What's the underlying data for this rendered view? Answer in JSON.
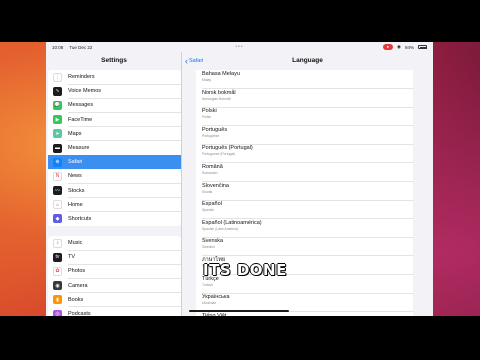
{
  "status_bar": {
    "time": "10:08",
    "date": "Tue Dec 22",
    "dots": "•••",
    "recording": "●",
    "wifi": "◉",
    "battery_pct": "94%"
  },
  "left": {
    "title": "Settings",
    "group1": [
      {
        "label": "Reminders",
        "icon": "reminders-icon",
        "color": "#ffffff",
        "glyph": "⋮"
      },
      {
        "label": "Voice Memos",
        "icon": "voice-memos-icon",
        "color": "#1c1c1e",
        "glyph": "∿"
      },
      {
        "label": "Messages",
        "icon": "messages-icon",
        "color": "#34c759",
        "glyph": "💬"
      },
      {
        "label": "FaceTime",
        "icon": "facetime-icon",
        "color": "#34c759",
        "glyph": "▶"
      },
      {
        "label": "Maps",
        "icon": "maps-icon",
        "color": "#5ac8a0",
        "glyph": "➤"
      },
      {
        "label": "Measure",
        "icon": "measure-icon",
        "color": "#1c1c1e",
        "glyph": "▬"
      },
      {
        "label": "Safari",
        "icon": "safari-icon",
        "color": "#0a84ff",
        "glyph": "⊕",
        "selected": true
      },
      {
        "label": "News",
        "icon": "news-icon",
        "color": "#ffffff",
        "glyph": "N"
      },
      {
        "label": "Stocks",
        "icon": "stocks-icon",
        "color": "#1c1c1e",
        "glyph": "〰"
      },
      {
        "label": "Home",
        "icon": "home-icon",
        "color": "#ffffff",
        "glyph": "⌂"
      },
      {
        "label": "Shortcuts",
        "icon": "shortcuts-icon",
        "color": "#5e5ce6",
        "glyph": "◆"
      }
    ],
    "group2": [
      {
        "label": "Music",
        "icon": "music-icon",
        "color": "#ffffff",
        "glyph": "♪"
      },
      {
        "label": "TV",
        "icon": "tv-icon",
        "color": "#1c1c1e",
        "glyph": "tv"
      },
      {
        "label": "Photos",
        "icon": "photos-icon",
        "color": "#ffffff",
        "glyph": "✿"
      },
      {
        "label": "Camera",
        "icon": "camera-icon",
        "color": "#3a3a3c",
        "glyph": "◉"
      },
      {
        "label": "Books",
        "icon": "books-icon",
        "color": "#ff9500",
        "glyph": "▮"
      },
      {
        "label": "Podcasts",
        "icon": "podcasts-icon",
        "color": "#af52de",
        "glyph": "◎"
      }
    ]
  },
  "right": {
    "back_label": "Safari",
    "title": "Language",
    "languages": [
      {
        "name": "Bahasa Melayu",
        "sub": "Malay"
      },
      {
        "name": "Norsk bokmål",
        "sub": "Norwegian Bokmål"
      },
      {
        "name": "Polski",
        "sub": "Polish"
      },
      {
        "name": "Português",
        "sub": "Portuguese"
      },
      {
        "name": "Português (Portugal)",
        "sub": "Portuguese (Portugal)"
      },
      {
        "name": "Română",
        "sub": "Romanian"
      },
      {
        "name": "Slovenčina",
        "sub": "Slovak"
      },
      {
        "name": "Español",
        "sub": "Spanish"
      },
      {
        "name": "Español (Latinoamérica)",
        "sub": "Spanish (Latin America)"
      },
      {
        "name": "Svenska",
        "sub": "Swedish"
      },
      {
        "name": "ภาษาไทย",
        "sub": "Thai"
      },
      {
        "name": "Türkçe",
        "sub": "Turkish"
      },
      {
        "name": "Українська",
        "sub": "Ukrainian"
      },
      {
        "name": "Tiếng Việt",
        "sub": "Vietnamese"
      }
    ]
  },
  "caption": "ITS DONE"
}
